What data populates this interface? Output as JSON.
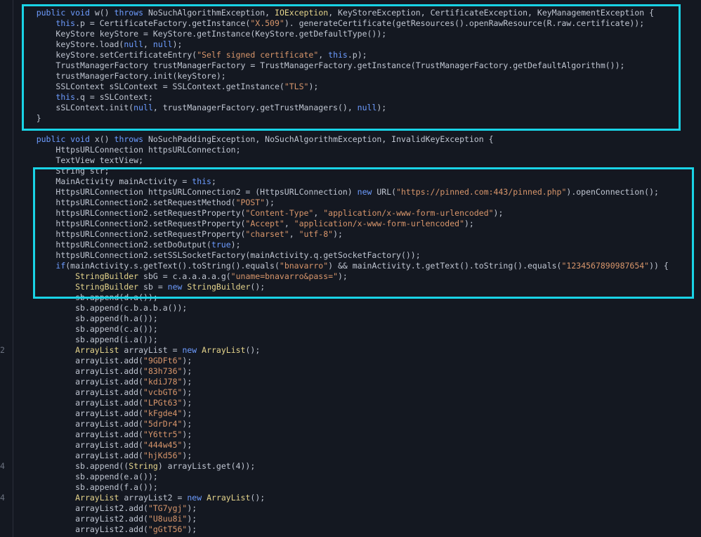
{
  "code": {
    "lines": [
      {
        "indent": "    ",
        "tokens": [
          [
            "kw",
            "public void"
          ],
          [
            "",
            "w() "
          ],
          [
            "kw",
            "throws"
          ],
          [
            "",
            "NoSuchAlgorithmException, "
          ],
          [
            "ty",
            "IOException"
          ],
          [
            "",
            ", KeyStoreException, CertificateException, KeyManagementException {"
          ]
        ]
      },
      {
        "indent": "        ",
        "tokens": [
          [
            "kw",
            "this"
          ],
          [
            "",
            ".p = CertificateFactory.getInstance("
          ],
          [
            "str",
            "\"X.509\""
          ],
          [
            "",
            "). generateCertificate(getResources().openRawResource(R.raw.certificate));"
          ]
        ]
      },
      {
        "indent": "        ",
        "tokens": [
          [
            "",
            "KeyStore keyStore = KeyStore.getInstance(KeyStore.getDefaultType());"
          ]
        ]
      },
      {
        "indent": "        ",
        "tokens": [
          [
            "",
            "keyStore.load("
          ],
          [
            "kw",
            "null"
          ],
          [
            "",
            ", "
          ],
          [
            "kw",
            "null"
          ],
          [
            "",
            ");"
          ]
        ]
      },
      {
        "indent": "        ",
        "tokens": [
          [
            "",
            "keyStore.setCertificateEntry("
          ],
          [
            "str",
            "\"Self signed certificate\""
          ],
          [
            "",
            ", "
          ],
          [
            "kw",
            "this"
          ],
          [
            "",
            ".p);"
          ]
        ]
      },
      {
        "indent": "        ",
        "tokens": [
          [
            "",
            "TrustManagerFactory trustManagerFactory = TrustManagerFactory.getInstance(TrustManagerFactory.getDefaultAlgorithm());"
          ]
        ]
      },
      {
        "indent": "        ",
        "tokens": [
          [
            "",
            "trustManagerFactory.init(keyStore);"
          ]
        ]
      },
      {
        "indent": "        ",
        "tokens": [
          [
            "",
            "SSLContext sSLContext = SSLContext.getInstance("
          ],
          [
            "str",
            "\"TLS\""
          ],
          [
            "",
            ");"
          ]
        ]
      },
      {
        "indent": "        ",
        "tokens": [
          [
            "kw",
            "this"
          ],
          [
            "",
            ".q = sSLContext;"
          ]
        ]
      },
      {
        "indent": "        ",
        "tokens": [
          [
            "",
            "sSLContext.init("
          ],
          [
            "kw",
            "null"
          ],
          [
            "",
            ", trustManagerFactory.getTrustManagers(), "
          ],
          [
            "kw",
            "null"
          ],
          [
            "",
            ");"
          ]
        ]
      },
      {
        "indent": "    ",
        "tokens": [
          [
            "",
            "}"
          ]
        ]
      },
      {
        "indent": "",
        "tokens": [
          [
            "",
            ""
          ]
        ]
      },
      {
        "indent": "    ",
        "tokens": [
          [
            "kw",
            "public void"
          ],
          [
            "",
            "x() "
          ],
          [
            "kw",
            "throws"
          ],
          [
            "",
            "NoSuchPaddingException, NoSuchAlgorithmException, InvalidKeyException {"
          ]
        ]
      },
      {
        "indent": "        ",
        "tokens": [
          [
            "",
            "HttpsURLConnection httpsURLConnection;"
          ]
        ]
      },
      {
        "indent": "        ",
        "tokens": [
          [
            "",
            "TextView textView;"
          ]
        ]
      },
      {
        "indent": "        ",
        "tokens": [
          [
            "",
            "String str;"
          ]
        ]
      },
      {
        "indent": "        ",
        "tokens": [
          [
            "",
            "MainActivity mainActivity = "
          ],
          [
            "kw",
            "this"
          ],
          [
            "",
            ";"
          ]
        ]
      },
      {
        "indent": "        ",
        "tokens": [
          [
            "",
            "HttpsURLConnection httpsURLConnection2 = (HttpsURLConnection) "
          ],
          [
            "kw",
            "new"
          ],
          [
            "",
            "URL("
          ],
          [
            "str",
            "\"https://pinned.com:443/pinned.php\""
          ],
          [
            "",
            ").openConnection();"
          ]
        ]
      },
      {
        "indent": "        ",
        "tokens": [
          [
            "",
            "httpsURLConnection2.setRequestMethod("
          ],
          [
            "str",
            "\"POST\""
          ],
          [
            "",
            ");"
          ]
        ]
      },
      {
        "indent": "        ",
        "tokens": [
          [
            "",
            "httpsURLConnection2.setRequestProperty("
          ],
          [
            "str",
            "\"Content-Type\""
          ],
          [
            "",
            ", "
          ],
          [
            "str",
            "\"application/x-www-form-urlencoded\""
          ],
          [
            "",
            ");"
          ]
        ]
      },
      {
        "indent": "        ",
        "tokens": [
          [
            "",
            "httpsURLConnection2.setRequestProperty("
          ],
          [
            "str",
            "\"Accept\""
          ],
          [
            "",
            ", "
          ],
          [
            "str",
            "\"application/x-www-form-urlencoded\""
          ],
          [
            "",
            ");"
          ]
        ]
      },
      {
        "indent": "        ",
        "tokens": [
          [
            "",
            "httpsURLConnection2.setRequestProperty("
          ],
          [
            "str",
            "\"charset\""
          ],
          [
            "",
            ", "
          ],
          [
            "str",
            "\"utf-8\""
          ],
          [
            "",
            ");"
          ]
        ]
      },
      {
        "indent": "        ",
        "tokens": [
          [
            "",
            "httpsURLConnection2.setDoOutput("
          ],
          [
            "kw",
            "true"
          ],
          [
            "",
            ");"
          ]
        ]
      },
      {
        "indent": "        ",
        "tokens": [
          [
            "",
            "httpsURLConnection2.setSSLSocketFactory(mainActivity.q.getSocketFactory());"
          ]
        ]
      },
      {
        "indent": "        ",
        "tokens": [
          [
            "kw",
            "if"
          ],
          [
            "",
            "(mainActivity.s.getText().toString().equals("
          ],
          [
            "str",
            "\"bnavarro\""
          ],
          [
            "",
            ") && mainActivity.t.getText().toString().equals("
          ],
          [
            "str",
            "\"1234567890987654\""
          ],
          [
            "",
            ")) {"
          ]
        ]
      },
      {
        "indent": "            ",
        "tokens": [
          [
            "ty",
            "StringBuilder"
          ],
          [
            "",
            "sbG = c.a.a.a.a.g("
          ],
          [
            "str",
            "\"uname=bnavarro&pass=\""
          ],
          [
            "",
            ");"
          ]
        ]
      },
      {
        "indent": "            ",
        "tokens": [
          [
            "ty",
            "StringBuilder"
          ],
          [
            "",
            "sb = "
          ],
          [
            "kw",
            "new"
          ],
          [
            "ty",
            "StringBuilder"
          ],
          [
            "",
            "();"
          ]
        ]
      },
      {
        "indent": "            ",
        "tokens": [
          [
            "",
            "sb.append(d.a());"
          ]
        ]
      },
      {
        "indent": "            ",
        "tokens": [
          [
            "",
            "sb.append(c.b.a.b.a());"
          ]
        ]
      },
      {
        "indent": "            ",
        "tokens": [
          [
            "",
            "sb.append(h.a());"
          ]
        ]
      },
      {
        "indent": "            ",
        "tokens": [
          [
            "",
            "sb.append(c.a());"
          ]
        ]
      },
      {
        "indent": "            ",
        "tokens": [
          [
            "",
            "sb.append(i.a());"
          ]
        ]
      },
      {
        "indent": "            ",
        "ln": "2",
        "tokens": [
          [
            "ty",
            "ArrayList"
          ],
          [
            "",
            "arrayList = "
          ],
          [
            "kw",
            "new"
          ],
          [
            "ty",
            "ArrayList"
          ],
          [
            "",
            "();"
          ]
        ]
      },
      {
        "indent": "            ",
        "tokens": [
          [
            "",
            "arrayList.add("
          ],
          [
            "str",
            "\"9GDFt6\""
          ],
          [
            "",
            ");"
          ]
        ]
      },
      {
        "indent": "            ",
        "tokens": [
          [
            "",
            "arrayList.add("
          ],
          [
            "str",
            "\"83h736\""
          ],
          [
            "",
            ");"
          ]
        ]
      },
      {
        "indent": "            ",
        "tokens": [
          [
            "",
            "arrayList.add("
          ],
          [
            "str",
            "\"kdiJ78\""
          ],
          [
            "",
            ");"
          ]
        ]
      },
      {
        "indent": "            ",
        "tokens": [
          [
            "",
            "arrayList.add("
          ],
          [
            "str",
            "\"vcbGT6\""
          ],
          [
            "",
            ");"
          ]
        ]
      },
      {
        "indent": "            ",
        "tokens": [
          [
            "",
            "arrayList.add("
          ],
          [
            "str",
            "\"LPGt63\""
          ],
          [
            "",
            ");"
          ]
        ]
      },
      {
        "indent": "            ",
        "tokens": [
          [
            "",
            "arrayList.add("
          ],
          [
            "str",
            "\"kFgde4\""
          ],
          [
            "",
            ");"
          ]
        ]
      },
      {
        "indent": "            ",
        "tokens": [
          [
            "",
            "arrayList.add("
          ],
          [
            "str",
            "\"5drDr4\""
          ],
          [
            "",
            ");"
          ]
        ]
      },
      {
        "indent": "            ",
        "tokens": [
          [
            "",
            "arrayList.add("
          ],
          [
            "str",
            "\"Y6ttr5\""
          ],
          [
            "",
            ");"
          ]
        ]
      },
      {
        "indent": "            ",
        "tokens": [
          [
            "",
            "arrayList.add("
          ],
          [
            "str",
            "\"444w45\""
          ],
          [
            "",
            ");"
          ]
        ]
      },
      {
        "indent": "            ",
        "tokens": [
          [
            "",
            "arrayList.add("
          ],
          [
            "str",
            "\"hjKd56\""
          ],
          [
            "",
            ");"
          ]
        ]
      },
      {
        "indent": "            ",
        "ln": "4",
        "tokens": [
          [
            "",
            "sb.append(("
          ],
          [
            "ty",
            "String"
          ],
          [
            "",
            ") arrayList.get(4));"
          ]
        ]
      },
      {
        "indent": "            ",
        "tokens": [
          [
            "",
            "sb.append(e.a());"
          ]
        ]
      },
      {
        "indent": "            ",
        "tokens": [
          [
            "",
            "sb.append(f.a());"
          ]
        ]
      },
      {
        "indent": "            ",
        "ln": "4",
        "tokens": [
          [
            "ty",
            "ArrayList"
          ],
          [
            "",
            "arrayList2 = "
          ],
          [
            "kw",
            "new"
          ],
          [
            "ty",
            "ArrayList"
          ],
          [
            "",
            "();"
          ]
        ]
      },
      {
        "indent": "            ",
        "tokens": [
          [
            "",
            "arrayList2.add("
          ],
          [
            "str",
            "\"TG7ygj\""
          ],
          [
            "",
            ");"
          ]
        ]
      },
      {
        "indent": "            ",
        "tokens": [
          [
            "",
            "arrayList2.add("
          ],
          [
            "str",
            "\"U8uu8i\""
          ],
          [
            "",
            ");"
          ]
        ]
      },
      {
        "indent": "            ",
        "tokens": [
          [
            "",
            "arrayList2.add("
          ],
          [
            "str",
            "\"gGtT56\""
          ],
          [
            "",
            ");"
          ]
        ]
      }
    ]
  },
  "highlight_color": "#19d3e6",
  "colors": {
    "background": "#141821",
    "text": "#c0c6d2",
    "keyword": "#6d9cff",
    "string": "#d8966b",
    "type": "#e6d58c"
  }
}
